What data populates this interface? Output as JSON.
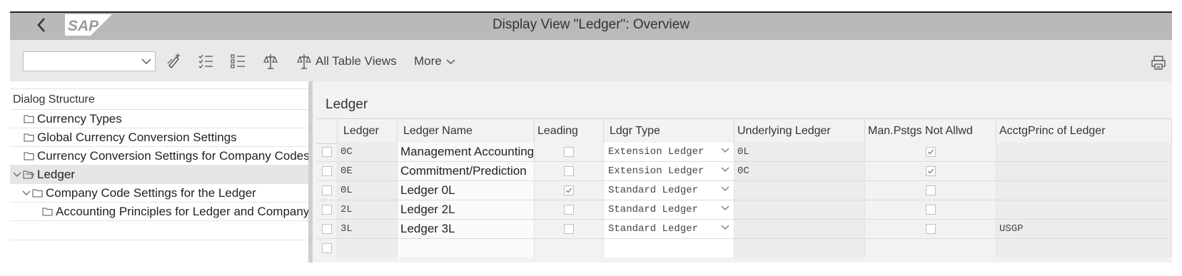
{
  "window": {
    "title": "Display View \"Ledger\": Overview"
  },
  "toolbar": {
    "combo_value": "",
    "all_table_views": "All Table Views",
    "more": "More"
  },
  "dialog_structure": {
    "header": "Dialog Structure",
    "items": [
      {
        "label": "Currency Types",
        "level": 0,
        "selected": false,
        "expanded": false
      },
      {
        "label": "Global Currency Conversion Settings",
        "level": 0,
        "selected": false,
        "expanded": false
      },
      {
        "label": "Currency Conversion Settings for Company Codes",
        "level": 0,
        "selected": false,
        "expanded": false
      },
      {
        "label": "Ledger",
        "level": 0,
        "selected": true,
        "expanded": true
      },
      {
        "label": "Company Code Settings for the Ledger",
        "level": 1,
        "selected": false,
        "expanded": true
      },
      {
        "label": "Accounting Principles for Ledger and Company C",
        "level": 2,
        "selected": false,
        "expanded": false
      }
    ]
  },
  "ledger_table": {
    "title": "Ledger",
    "columns": [
      "Ledger",
      "Ledger Name",
      "Leading",
      "Ldgr Type",
      "Underlying Ledger",
      "Man.Pstgs Not Allwd",
      "AcctgPrinc of Ledger"
    ],
    "rows": [
      {
        "ledger": "0C",
        "name": "Management Accounting",
        "leading": false,
        "type": "Extension Ledger",
        "underlying": "0L",
        "man_pstgs": true,
        "acctg_princ": ""
      },
      {
        "ledger": "0E",
        "name": "Commitment/Prediction",
        "leading": false,
        "type": "Extension Ledger",
        "underlying": "0C",
        "man_pstgs": true,
        "acctg_princ": ""
      },
      {
        "ledger": "0L",
        "name": "Ledger 0L",
        "leading": true,
        "type": "Standard Ledger",
        "underlying": "",
        "man_pstgs": false,
        "acctg_princ": ""
      },
      {
        "ledger": "2L",
        "name": "Ledger 2L",
        "leading": false,
        "type": "Standard Ledger",
        "underlying": "",
        "man_pstgs": false,
        "acctg_princ": ""
      },
      {
        "ledger": "3L",
        "name": "Ledger 3L",
        "leading": false,
        "type": "Standard Ledger",
        "underlying": "",
        "man_pstgs": false,
        "acctg_princ": "USGP"
      }
    ]
  },
  "icons": [
    "back-icon",
    "sap-logo",
    "dropdown-chevron-icon",
    "display-change-icon",
    "select-all-icon",
    "deselect-all-icon",
    "select-block-icon",
    "table-views-icon",
    "print-icon",
    "folder-icon",
    "tree-expand-icon"
  ],
  "colors": {
    "titlebar": "#b9b9b9",
    "toolbar": "#e9e9e9",
    "logo_blue": "#1a6fc2",
    "selected_row": "#e6e6e6"
  }
}
